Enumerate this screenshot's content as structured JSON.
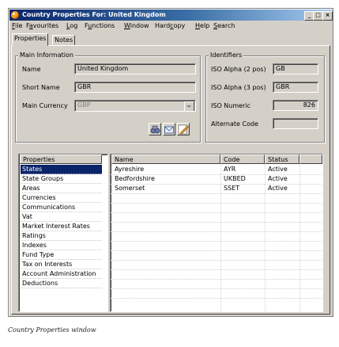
{
  "window": {
    "title": "Country Properties For: United Kingdom",
    "controls": {
      "minimize": "_",
      "maximize": "□",
      "close": "×"
    }
  },
  "menubar": {
    "items": [
      {
        "key": "F",
        "rest": "ile"
      },
      {
        "key": "a",
        "pre": "F",
        "rest": "vourites"
      },
      {
        "key": "L",
        "rest": "og"
      },
      {
        "key": "u",
        "pre": "F",
        "rest": "nctions"
      },
      {
        "key": "W",
        "rest": "indow"
      },
      {
        "key": "c",
        "pre": "Hard",
        "rest": "opy"
      },
      {
        "key": "H",
        "rest": "elp"
      },
      {
        "key": "S",
        "rest": "earch"
      }
    ]
  },
  "tabs": [
    {
      "label": "Properties",
      "active": true
    },
    {
      "label": "Notes",
      "active": false
    }
  ],
  "main_info": {
    "group_label": "Main Information",
    "name_label": "Name",
    "name_value": "United Kingdom",
    "short_name_label": "Short Name",
    "short_name_value": "GBR",
    "currency_label": "Main Currency",
    "currency_value": "GBP"
  },
  "identifiers": {
    "group_label": "Identifiers",
    "iso2_label": "ISO Alpha (2 pos)",
    "iso2_value": "GB",
    "iso3_label": "ISO Alpha (3 pos)",
    "iso3_value": "GBR",
    "numeric_label": "ISO Numeric",
    "numeric_value": "826",
    "alt_label": "Alternate Code",
    "alt_value": ""
  },
  "toolbar_icons": [
    "binoculars-icon",
    "mail-icon",
    "edit-pencil-icon"
  ],
  "properties_list": {
    "header": "Properties",
    "items": [
      "States",
      "State Groups",
      "Areas",
      "Currencies",
      "Communications",
      "Vat",
      "Market Interest Rates",
      "Ratings",
      "Indexes",
      "Fund Type",
      "Tax on Interests",
      "Account Administration",
      "Deductions"
    ],
    "selected": "States"
  },
  "states_grid": {
    "columns": [
      "Name",
      "Code",
      "Status"
    ],
    "rows": [
      {
        "name": "Ayreshire",
        "code": "AYR",
        "status": "Active"
      },
      {
        "name": "Bedfordshire",
        "code": "UKBED",
        "status": "Active"
      },
      {
        "name": "Somerset",
        "code": "SSET",
        "status": "Active"
      }
    ]
  },
  "caption": "Country Properties window",
  "colors": {
    "titlebar": "#0a246a",
    "selection": "#0a246a",
    "face": "#d4d0c8"
  }
}
